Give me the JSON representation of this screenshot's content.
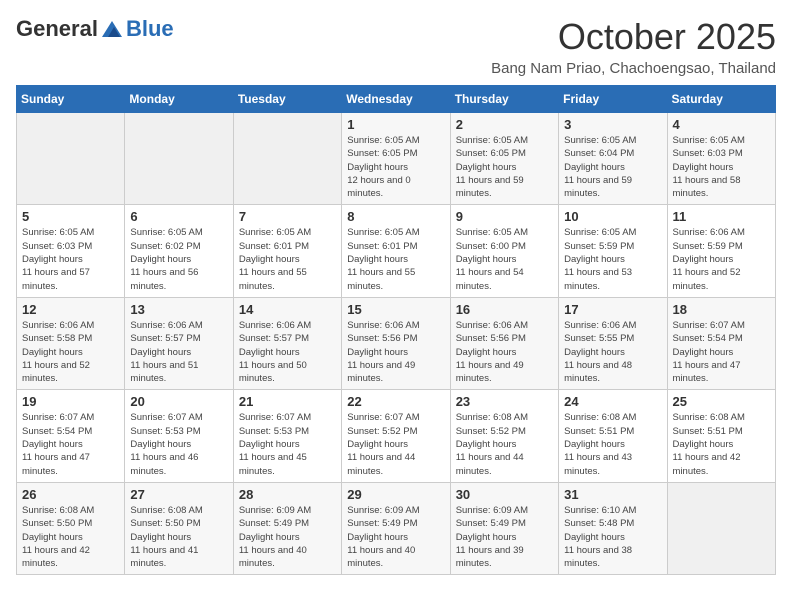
{
  "header": {
    "logo_general": "General",
    "logo_blue": "Blue",
    "month": "October 2025",
    "location": "Bang Nam Priao, Chachoengsao, Thailand"
  },
  "weekdays": [
    "Sunday",
    "Monday",
    "Tuesday",
    "Wednesday",
    "Thursday",
    "Friday",
    "Saturday"
  ],
  "weeks": [
    [
      {
        "day": "",
        "empty": true
      },
      {
        "day": "",
        "empty": true
      },
      {
        "day": "",
        "empty": true
      },
      {
        "day": "1",
        "sunrise": "6:05 AM",
        "sunset": "6:05 PM",
        "daylight": "12 hours and 0 minutes."
      },
      {
        "day": "2",
        "sunrise": "6:05 AM",
        "sunset": "6:05 PM",
        "daylight": "11 hours and 59 minutes."
      },
      {
        "day": "3",
        "sunrise": "6:05 AM",
        "sunset": "6:04 PM",
        "daylight": "11 hours and 59 minutes."
      },
      {
        "day": "4",
        "sunrise": "6:05 AM",
        "sunset": "6:03 PM",
        "daylight": "11 hours and 58 minutes."
      }
    ],
    [
      {
        "day": "5",
        "sunrise": "6:05 AM",
        "sunset": "6:03 PM",
        "daylight": "11 hours and 57 minutes."
      },
      {
        "day": "6",
        "sunrise": "6:05 AM",
        "sunset": "6:02 PM",
        "daylight": "11 hours and 56 minutes."
      },
      {
        "day": "7",
        "sunrise": "6:05 AM",
        "sunset": "6:01 PM",
        "daylight": "11 hours and 55 minutes."
      },
      {
        "day": "8",
        "sunrise": "6:05 AM",
        "sunset": "6:01 PM",
        "daylight": "11 hours and 55 minutes."
      },
      {
        "day": "9",
        "sunrise": "6:05 AM",
        "sunset": "6:00 PM",
        "daylight": "11 hours and 54 minutes."
      },
      {
        "day": "10",
        "sunrise": "6:05 AM",
        "sunset": "5:59 PM",
        "daylight": "11 hours and 53 minutes."
      },
      {
        "day": "11",
        "sunrise": "6:06 AM",
        "sunset": "5:59 PM",
        "daylight": "11 hours and 52 minutes."
      }
    ],
    [
      {
        "day": "12",
        "sunrise": "6:06 AM",
        "sunset": "5:58 PM",
        "daylight": "11 hours and 52 minutes."
      },
      {
        "day": "13",
        "sunrise": "6:06 AM",
        "sunset": "5:57 PM",
        "daylight": "11 hours and 51 minutes."
      },
      {
        "day": "14",
        "sunrise": "6:06 AM",
        "sunset": "5:57 PM",
        "daylight": "11 hours and 50 minutes."
      },
      {
        "day": "15",
        "sunrise": "6:06 AM",
        "sunset": "5:56 PM",
        "daylight": "11 hours and 49 minutes."
      },
      {
        "day": "16",
        "sunrise": "6:06 AM",
        "sunset": "5:56 PM",
        "daylight": "11 hours and 49 minutes."
      },
      {
        "day": "17",
        "sunrise": "6:06 AM",
        "sunset": "5:55 PM",
        "daylight": "11 hours and 48 minutes."
      },
      {
        "day": "18",
        "sunrise": "6:07 AM",
        "sunset": "5:54 PM",
        "daylight": "11 hours and 47 minutes."
      }
    ],
    [
      {
        "day": "19",
        "sunrise": "6:07 AM",
        "sunset": "5:54 PM",
        "daylight": "11 hours and 47 minutes."
      },
      {
        "day": "20",
        "sunrise": "6:07 AM",
        "sunset": "5:53 PM",
        "daylight": "11 hours and 46 minutes."
      },
      {
        "day": "21",
        "sunrise": "6:07 AM",
        "sunset": "5:53 PM",
        "daylight": "11 hours and 45 minutes."
      },
      {
        "day": "22",
        "sunrise": "6:07 AM",
        "sunset": "5:52 PM",
        "daylight": "11 hours and 44 minutes."
      },
      {
        "day": "23",
        "sunrise": "6:08 AM",
        "sunset": "5:52 PM",
        "daylight": "11 hours and 44 minutes."
      },
      {
        "day": "24",
        "sunrise": "6:08 AM",
        "sunset": "5:51 PM",
        "daylight": "11 hours and 43 minutes."
      },
      {
        "day": "25",
        "sunrise": "6:08 AM",
        "sunset": "5:51 PM",
        "daylight": "11 hours and 42 minutes."
      }
    ],
    [
      {
        "day": "26",
        "sunrise": "6:08 AM",
        "sunset": "5:50 PM",
        "daylight": "11 hours and 42 minutes."
      },
      {
        "day": "27",
        "sunrise": "6:08 AM",
        "sunset": "5:50 PM",
        "daylight": "11 hours and 41 minutes."
      },
      {
        "day": "28",
        "sunrise": "6:09 AM",
        "sunset": "5:49 PM",
        "daylight": "11 hours and 40 minutes."
      },
      {
        "day": "29",
        "sunrise": "6:09 AM",
        "sunset": "5:49 PM",
        "daylight": "11 hours and 40 minutes."
      },
      {
        "day": "30",
        "sunrise": "6:09 AM",
        "sunset": "5:49 PM",
        "daylight": "11 hours and 39 minutes."
      },
      {
        "day": "31",
        "sunrise": "6:10 AM",
        "sunset": "5:48 PM",
        "daylight": "11 hours and 38 minutes."
      },
      {
        "day": "",
        "empty": true
      }
    ]
  ],
  "labels": {
    "sunrise": "Sunrise:",
    "sunset": "Sunset:",
    "daylight": "Daylight hours"
  }
}
